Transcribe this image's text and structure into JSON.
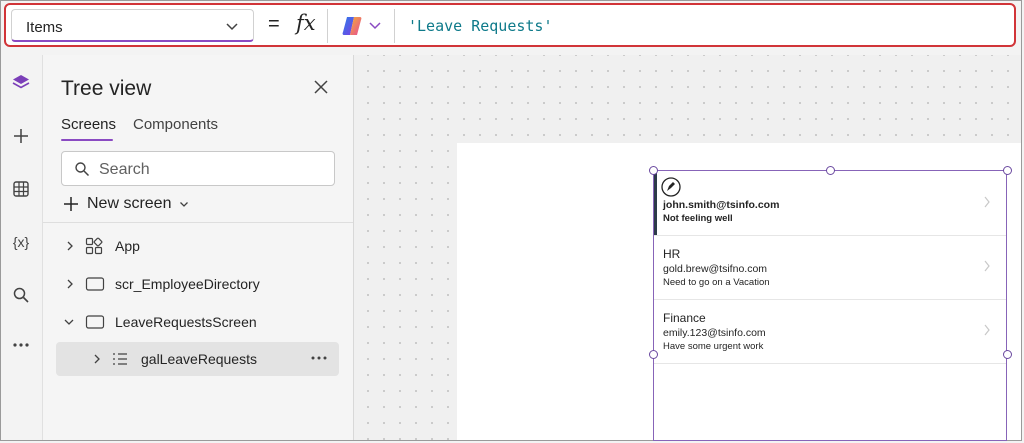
{
  "formula_bar": {
    "property": "Items",
    "equals": "=",
    "fx": "fx",
    "formula": "'Leave Requests'"
  },
  "tree_view": {
    "title": "Tree view",
    "tabs": [
      {
        "label": "Screens",
        "active": true
      },
      {
        "label": "Components",
        "active": false
      }
    ],
    "search_placeholder": "Search",
    "new_screen_label": "New screen",
    "nodes": [
      {
        "label": "App",
        "icon": "app-icon",
        "expanded": false
      },
      {
        "label": "scr_EmployeeDirectory",
        "icon": "screen-icon",
        "expanded": false
      },
      {
        "label": "LeaveRequestsScreen",
        "icon": "screen-icon",
        "expanded": true
      },
      {
        "label": "galLeaveRequests",
        "icon": "gallery-icon",
        "expanded": false,
        "selected": true
      }
    ]
  },
  "rail": {
    "icons": [
      "layers-icon",
      "plus-icon",
      "table-icon",
      "variables-icon",
      "search-icon",
      "more-icon"
    ],
    "variables_text": "{x}"
  },
  "gallery": {
    "items": [
      {
        "line1": "",
        "line2": "john.smith@tsinfo.com",
        "line3": "Not feeling well",
        "selected": true
      },
      {
        "line1": "HR",
        "line2": "gold.brew@tsifno.com",
        "line3": "Need to go on a Vacation",
        "selected": false
      },
      {
        "line1": "Finance",
        "line2": "emily.123@tsinfo.com",
        "line3": "Have some urgent work",
        "selected": false
      }
    ]
  },
  "colors": {
    "accent": "#8a4ac2",
    "highlight_border": "#d13438",
    "formula_text": "#0e7a8a"
  }
}
